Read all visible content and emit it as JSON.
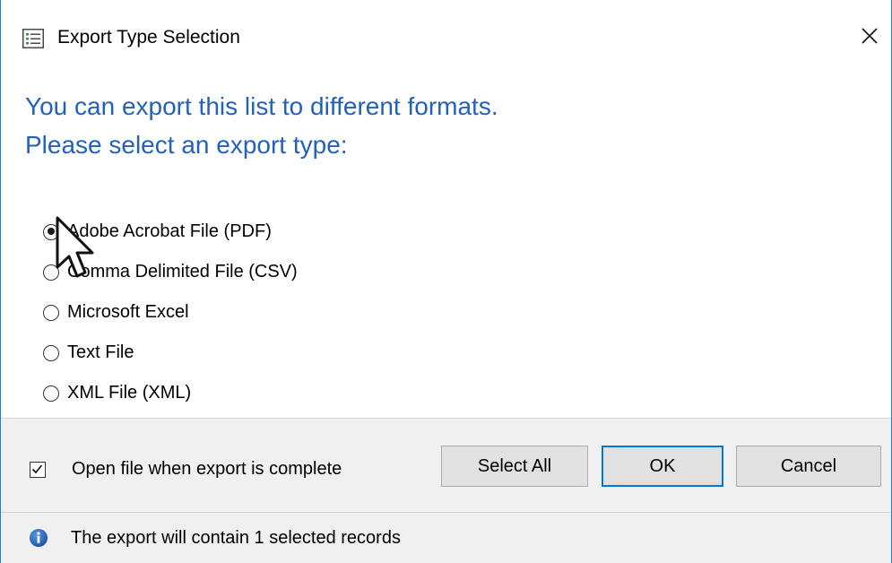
{
  "window": {
    "title": "Export Type Selection",
    "accent_color": "#1883d7"
  },
  "heading": {
    "line1": "You can export this list to different formats.",
    "line2": "Please select an export type:",
    "color": "#2461b8"
  },
  "export_options": [
    {
      "label": "Adobe Acrobat File (PDF)",
      "selected": true
    },
    {
      "label": "Comma Delimited File (CSV)",
      "selected": false
    },
    {
      "label": "Microsoft Excel",
      "selected": false
    },
    {
      "label": "Text File",
      "selected": false
    },
    {
      "label": "XML File (XML)",
      "selected": false
    }
  ],
  "footer": {
    "open_file_label": "Open file when export is complete",
    "open_file_checked": true,
    "select_all_label": "Select All",
    "ok_label": "OK",
    "cancel_label": "Cancel"
  },
  "status": {
    "text": "The export will contain 1 selected records",
    "icon": "info-icon"
  }
}
